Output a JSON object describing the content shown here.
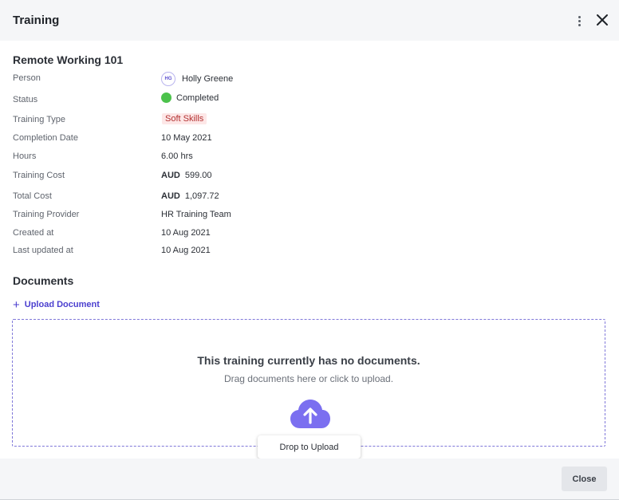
{
  "header": {
    "title": "Training",
    "menu_icon": "more-vertical-icon",
    "close_icon": "close-icon"
  },
  "training": {
    "name": "Remote Working 101",
    "fields": {
      "person": {
        "label": "Person",
        "avatar_initials": "HG",
        "value": "Holly Greene"
      },
      "status": {
        "label": "Status",
        "value": "Completed",
        "color": "#4cc24c"
      },
      "training_type": {
        "label": "Training Type",
        "value": "Soft Skills"
      },
      "completion_date": {
        "label": "Completion Date",
        "value": "10 May 2021"
      },
      "hours": {
        "label": "Hours",
        "value": "6.00 hrs"
      },
      "training_cost": {
        "label": "Training Cost",
        "currency": "AUD",
        "amount": "599.00"
      },
      "total_cost": {
        "label": "Total Cost",
        "currency": "AUD",
        "amount": "1,097.72"
      },
      "training_provider": {
        "label": "Training Provider",
        "value": "HR Training Team"
      },
      "created_at": {
        "label": "Created at",
        "value": "10 Aug 2021"
      },
      "last_updated_at": {
        "label": "Last updated at",
        "value": "10 Aug 2021"
      }
    }
  },
  "documents": {
    "title": "Documents",
    "upload_label": "Upload Document",
    "empty_title": "This training currently has no documents.",
    "empty_subtitle": "Drag documents here or click to upload.",
    "cloud_icon": "cloud-upload-icon",
    "drop_label": "Drop to Upload"
  },
  "footer": {
    "close_label": "Close"
  },
  "colors": {
    "accent": "#4b3fcf",
    "cloud": "#7b6ff0",
    "tag_bg": "#fde7e7",
    "tag_text": "#b33232"
  }
}
